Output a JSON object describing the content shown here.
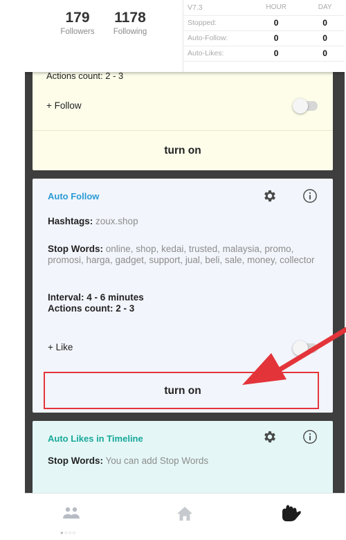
{
  "header": {
    "followers_count": "179",
    "followers_label": "Followers",
    "following_count": "1178",
    "following_label": "Following",
    "stats": {
      "version": "V7.3",
      "col_hour": "HOUR",
      "col_day": "DAY",
      "rows": [
        {
          "label": "Stopped:",
          "hour": "0",
          "day": "0"
        },
        {
          "label": "Auto-Follow:",
          "hour": "0",
          "day": "0"
        },
        {
          "label": "Auto-Likes:",
          "hour": "0",
          "day": "0"
        }
      ]
    }
  },
  "card_follow": {
    "cut_text": "Actions count: 2 - 3",
    "toggle_label": "+ Follow",
    "toggle_on": false,
    "button_label": "turn on"
  },
  "card_auto_follow": {
    "title": "Auto Follow",
    "hashtags_label": "Hashtags:",
    "hashtags_value": "zoux.shop",
    "stop_words_label": "Stop Words:",
    "stop_words_value": "online, shop, kedai, trusted, malaysia, promo, promosi, harga, gadget, support, jual, beli, sale, money, collector",
    "interval": "Interval: 4 - 6 minutes",
    "actions_count": "Actions count: 2 - 3",
    "toggle_label": "+ Like",
    "toggle_on": false,
    "button_label": "turn on"
  },
  "card_auto_likes": {
    "title": "Auto Likes in Timeline",
    "stop_words_label": "Stop Words:",
    "stop_words_placeholder": "You can add Stop Words"
  },
  "bottom_nav": {
    "active_index": 0,
    "items": [
      "people-icon",
      "home-icon",
      "hand-icon"
    ]
  },
  "colors": {
    "follow_card": "#fdfdea",
    "auto_follow_card": "#f2f5fb",
    "auto_likes_card": "#e4f7f6",
    "auto_follow_title": "#2b9bd6",
    "auto_likes_title": "#18a89a",
    "annotation_red": "#e3343a"
  }
}
